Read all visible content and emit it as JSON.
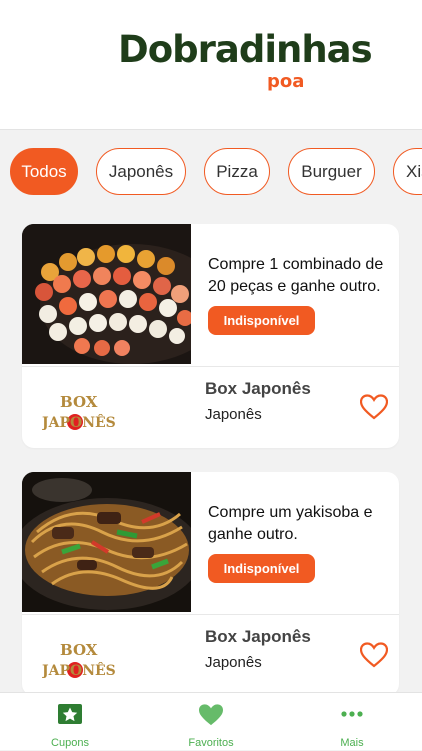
{
  "header": {
    "logo_title": "Dobradinhas",
    "logo_subtitle": "poa"
  },
  "categories": [
    {
      "label": "Todos",
      "active": true
    },
    {
      "label": "Japonês",
      "active": false
    },
    {
      "label": "Pizza",
      "active": false
    },
    {
      "label": "Burguer",
      "active": false
    },
    {
      "label": "Xis",
      "active": false
    }
  ],
  "coupons": [
    {
      "image": "sushi-platter",
      "offer": "Compre 1 combinado de 20 peças e ganhe outro.",
      "status": "Indisponível",
      "store_logo_top": "BOX",
      "store_logo_bottom": "JAPONÊS",
      "store_name": "Box Japonês",
      "store_category": "Japonês"
    },
    {
      "image": "yakisoba-dish",
      "offer": "Compre um yakisoba e ganhe outro.",
      "status": "Indisponível",
      "store_logo_top": "BOX",
      "store_logo_bottom": "JAPONÊS",
      "store_name": "Box Japonês",
      "store_category": "Japonês"
    }
  ],
  "tabbar": {
    "coupons": "Cupons",
    "favorites": "Favoritos",
    "more": "Mais"
  },
  "colors": {
    "accent": "#f15a22",
    "brand_green": "#1f3d1a",
    "tab_green": "#4caf50"
  }
}
